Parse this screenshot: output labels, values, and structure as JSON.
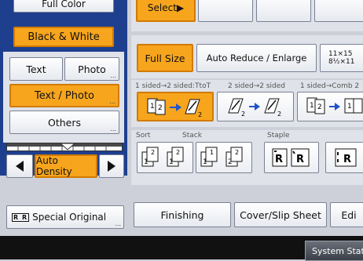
{
  "left_panel": {
    "full_color_label": "Full Color",
    "black_white_label": "Black & White",
    "text_label": "Text",
    "photo_label": "Photo",
    "text_photo_label": "Text / Photo",
    "others_label": "Others",
    "auto_density_label": "Auto Density",
    "special_original_label": "Special Original",
    "special_original_icon_text": "R R"
  },
  "top_row": {
    "select_label": "Select▶"
  },
  "reduce_row": {
    "full_size_label": "Full Size",
    "auto_reduce_label": "Auto Reduce / Enlarge",
    "size_top": "11×15",
    "size_bottom": "8½×11"
  },
  "duplex_row": {
    "caption_1": "1 sided→2 sided:TtoT",
    "caption_2": "2 sided→2 sided",
    "caption_3": "1 sided→Comb 2"
  },
  "finish_row": {
    "sort_caption": "Sort",
    "stack_caption": "Stack",
    "staple_caption": "Staple"
  },
  "bottom_tabs": {
    "finishing_label": "Finishing",
    "cover_label": "Cover/Slip Sheet",
    "edit_label": "Edi"
  },
  "status": {
    "system_status_label": "System Stat"
  },
  "colors": {
    "accent_orange": "#f7a51d",
    "panel_blue": "#1e3f8e",
    "background": "#cdd0d8"
  }
}
